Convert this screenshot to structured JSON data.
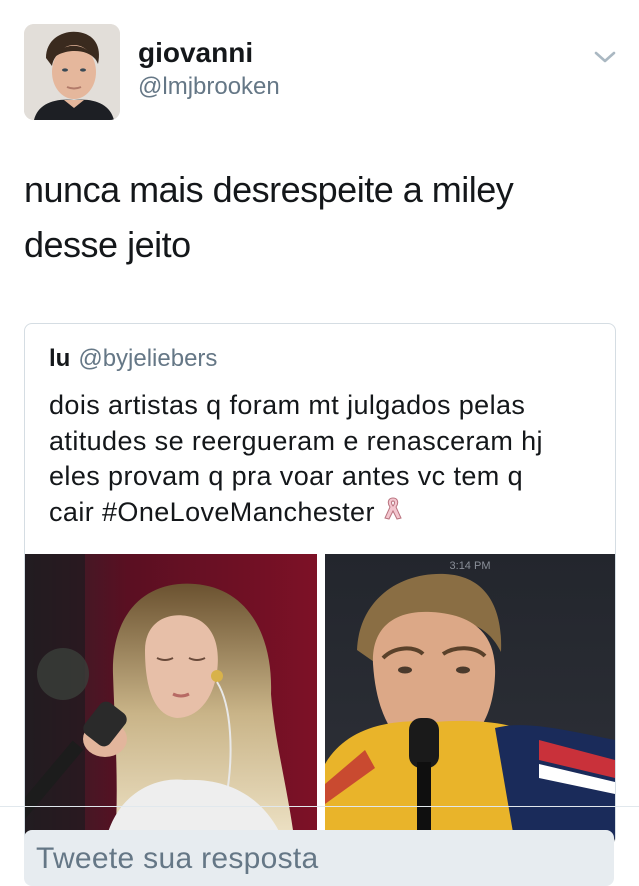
{
  "author": {
    "display_name": "giovanni",
    "handle": "@lmjbrooken"
  },
  "tweet": {
    "text_line1": "nunca mais desrespeite a miley",
    "text_line2": "desse jeito"
  },
  "quoted_tweet": {
    "display_name": "lu",
    "handle": "@byjeliebers",
    "text_line1": "dois artistas q foram mt julgados pelas",
    "text_line2": "atitudes se reergueram e renasceram hj",
    "text_line3": "eles provam q pra voar antes vc tem q",
    "text_line4": "cair #OneLoveManchester",
    "emoji": "ribbon-icon",
    "photos": [
      {
        "name": "miley-performing-photo"
      },
      {
        "name": "justin-performing-photo",
        "overlay_text": "3:14 PM"
      }
    ]
  },
  "reply": {
    "placeholder": "Tweete sua resposta"
  },
  "colors": {
    "secondary_text": "#657786",
    "border": "#d5dde3",
    "reply_bg": "#e7ecf0"
  }
}
